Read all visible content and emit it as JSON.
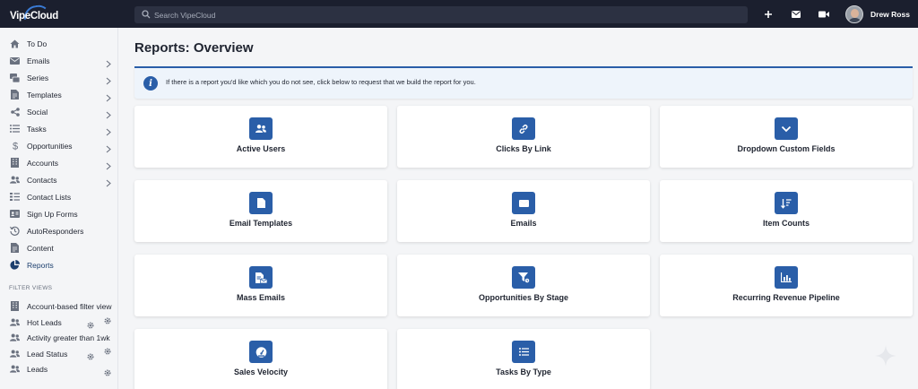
{
  "app": {
    "logo_text": "VipeCloud"
  },
  "topbar": {
    "search_placeholder": "Search VipeCloud",
    "icons": [
      "plus-icon",
      "mail-icon",
      "video-icon"
    ],
    "user_name": "Drew Ross"
  },
  "sidebar": {
    "items": [
      {
        "label": "To Do",
        "icon": "home-icon",
        "has_chevron": false
      },
      {
        "label": "Emails",
        "icon": "envelope-icon",
        "has_chevron": true
      },
      {
        "label": "Series",
        "icon": "series-icon",
        "has_chevron": true
      },
      {
        "label": "Templates",
        "icon": "file-icon",
        "has_chevron": true
      },
      {
        "label": "Social",
        "icon": "share-icon",
        "has_chevron": true
      },
      {
        "label": "Tasks",
        "icon": "list-icon",
        "has_chevron": true
      },
      {
        "label": "Opportunities",
        "icon": "dollar-icon",
        "has_chevron": true
      },
      {
        "label": "Accounts",
        "icon": "building-icon",
        "has_chevron": true
      },
      {
        "label": "Contacts",
        "icon": "users-icon",
        "has_chevron": true
      },
      {
        "label": "Contact Lists",
        "icon": "contact-list-icon",
        "has_chevron": false
      },
      {
        "label": "Sign Up Forms",
        "icon": "id-card-icon",
        "has_chevron": false
      },
      {
        "label": "AutoResponders",
        "icon": "history-icon",
        "has_chevron": false
      },
      {
        "label": "Content",
        "icon": "file-icon",
        "has_chevron": false
      },
      {
        "label": "Reports",
        "icon": "pie-chart-icon",
        "has_chevron": false,
        "active": true
      }
    ],
    "filter_section_label": "FILTER VIEWS",
    "filter_views": [
      {
        "label": "Account-based filter view",
        "icon": "building-icon"
      },
      {
        "label": "Hot Leads",
        "icon": "users-icon"
      },
      {
        "label": "Activity greater than 1wk",
        "icon": "users-icon"
      },
      {
        "label": "Lead Status",
        "icon": "users-icon"
      },
      {
        "label": "Leads",
        "icon": "users-icon"
      }
    ]
  },
  "main": {
    "title": "Reports: Overview",
    "info_message": "If there is a report you'd like which you do not see, click below to request that we build the report for you.",
    "cards": [
      {
        "label": "Active Users",
        "icon": "users-icon"
      },
      {
        "label": "Clicks By Link",
        "icon": "link-icon"
      },
      {
        "label": "Dropdown Custom Fields",
        "icon": "chevron-down-icon"
      },
      {
        "label": "Email Templates",
        "icon": "file-icon"
      },
      {
        "label": "Emails",
        "icon": "envelope-icon"
      },
      {
        "label": "Item Counts",
        "icon": "sort-icon"
      },
      {
        "label": "Mass Emails",
        "icon": "mass-email-icon"
      },
      {
        "label": "Opportunities By Stage",
        "icon": "funnel-icon"
      },
      {
        "label": "Recurring Revenue Pipeline",
        "icon": "bar-chart-icon"
      },
      {
        "label": "Sales Velocity",
        "icon": "gauge-icon"
      },
      {
        "label": "Tasks By Type",
        "icon": "list-icon"
      }
    ]
  },
  "colors": {
    "topbar_bg": "#1b1f2e",
    "accent": "#2a5ea8",
    "page_bg": "#f4f5f7",
    "info_bg": "#eef4fb"
  }
}
